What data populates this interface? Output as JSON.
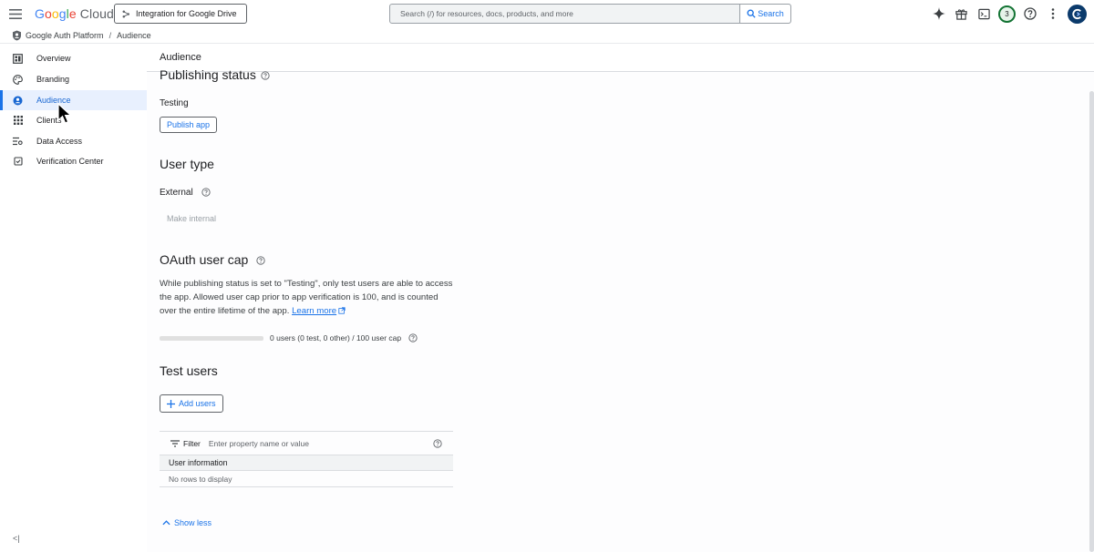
{
  "topbar": {
    "logo": {
      "g": "G",
      "o1": "o",
      "o2": "o",
      "g2": "g",
      "l": "l",
      "e": "e",
      "cloud": " Cloud"
    },
    "project_label": "Integration for Google Drive",
    "search_placeholder": "Search (/) for resources, docs, products, and more",
    "search_button": "Search",
    "notification_count": "3",
    "icons": [
      "menu-icon",
      "spark-icon",
      "gift-icon",
      "terminal-icon",
      "help-icon",
      "more-vert-icon",
      "avatar"
    ]
  },
  "breadcrumb": {
    "items": [
      "Google Auth Platform",
      "Audience"
    ],
    "separator": "/"
  },
  "sidebar": {
    "items": [
      {
        "label": "Overview",
        "icon": "dashboard-icon"
      },
      {
        "label": "Branding",
        "icon": "palette-icon"
      },
      {
        "label": "Audience",
        "icon": "person-icon",
        "active": true
      },
      {
        "label": "Clients",
        "icon": "grid-icon"
      },
      {
        "label": "Data Access",
        "icon": "tune-icon"
      },
      {
        "label": "Verification Center",
        "icon": "verified-icon"
      }
    ],
    "collapse_label": "<|"
  },
  "main": {
    "page_title": "Audience",
    "publishing_status": {
      "heading": "Publishing status",
      "value": "Testing",
      "button": "Publish app"
    },
    "user_type": {
      "heading": "User type",
      "value": "External",
      "button": "Make internal"
    },
    "oauth_cap": {
      "heading": "OAuth user cap",
      "description": "While publishing status is set to \"Testing\", only test users are able to access the app. Allowed user cap prior to app verification is 100, and is counted over the entire lifetime of the app.",
      "learn_more": "Learn more",
      "progress": 0,
      "cap_text": "0 users (0 test, 0 other) / 100 user cap"
    },
    "test_users": {
      "heading": "Test users",
      "add_button": "Add users",
      "filter_label": "Filter",
      "filter_placeholder": "Enter property name or value",
      "column_header": "User information",
      "empty_text": "No rows to display"
    },
    "show_less": "Show less"
  },
  "colors": {
    "accent": "#1a73e8",
    "active_bg": "#e8f0fe",
    "notif_border": "#137333"
  }
}
